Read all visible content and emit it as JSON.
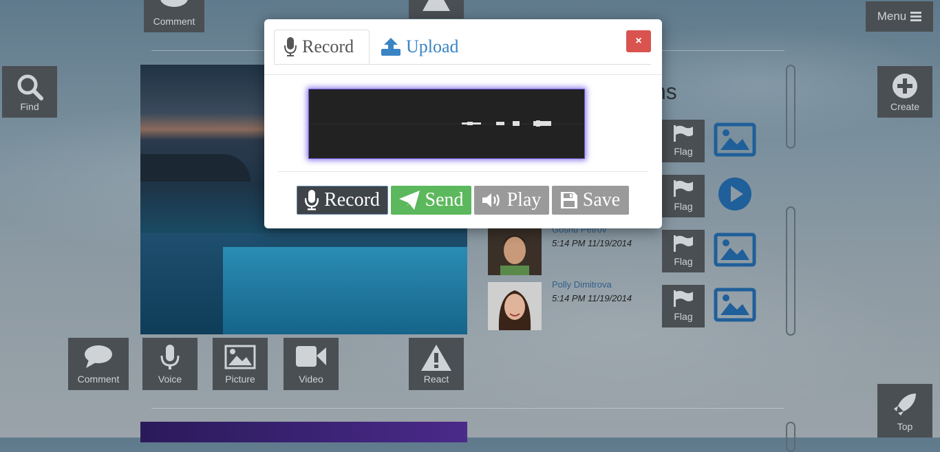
{
  "background": {
    "top_tiles": {
      "comment_label": "Comment"
    },
    "find": {
      "label": "Find"
    },
    "menu": {
      "label": "Menu"
    },
    "create": {
      "label": "Create"
    },
    "top": {
      "label": "Top"
    },
    "action_tiles": [
      {
        "label": "Comment",
        "icon": "comment-icon"
      },
      {
        "label": "Voice",
        "icon": "microphone-icon"
      },
      {
        "label": "Picture",
        "icon": "picture-icon"
      },
      {
        "label": "Video",
        "icon": "video-icon"
      },
      {
        "label": "React",
        "icon": "warning-icon"
      }
    ],
    "people_title": "ns",
    "people": [
      {
        "name": "Goshu Petrov",
        "time": "5:14 PM 11/19/2014",
        "flag_label": "Flag",
        "media": "picture-icon"
      },
      {
        "name": "Polly Dimitrova",
        "time": "5:14 PM 11/19/2014",
        "flag_label": "Flag",
        "media": "picture-icon"
      }
    ],
    "flag_labels": [
      "Flag",
      "Flag",
      "Flag",
      "Flag"
    ]
  },
  "modal": {
    "tabs": [
      {
        "label": "Record",
        "icon": "microphone-icon",
        "active": true
      },
      {
        "label": "Upload",
        "icon": "upload-icon",
        "active": false
      }
    ],
    "close_label": "×",
    "buttons": {
      "record": "Record",
      "send": "Send",
      "play": "Play",
      "save": "Save"
    },
    "colors": {
      "send": "#5cb85c",
      "close": "#d9534f",
      "upload_link": "#3a84c4"
    }
  }
}
